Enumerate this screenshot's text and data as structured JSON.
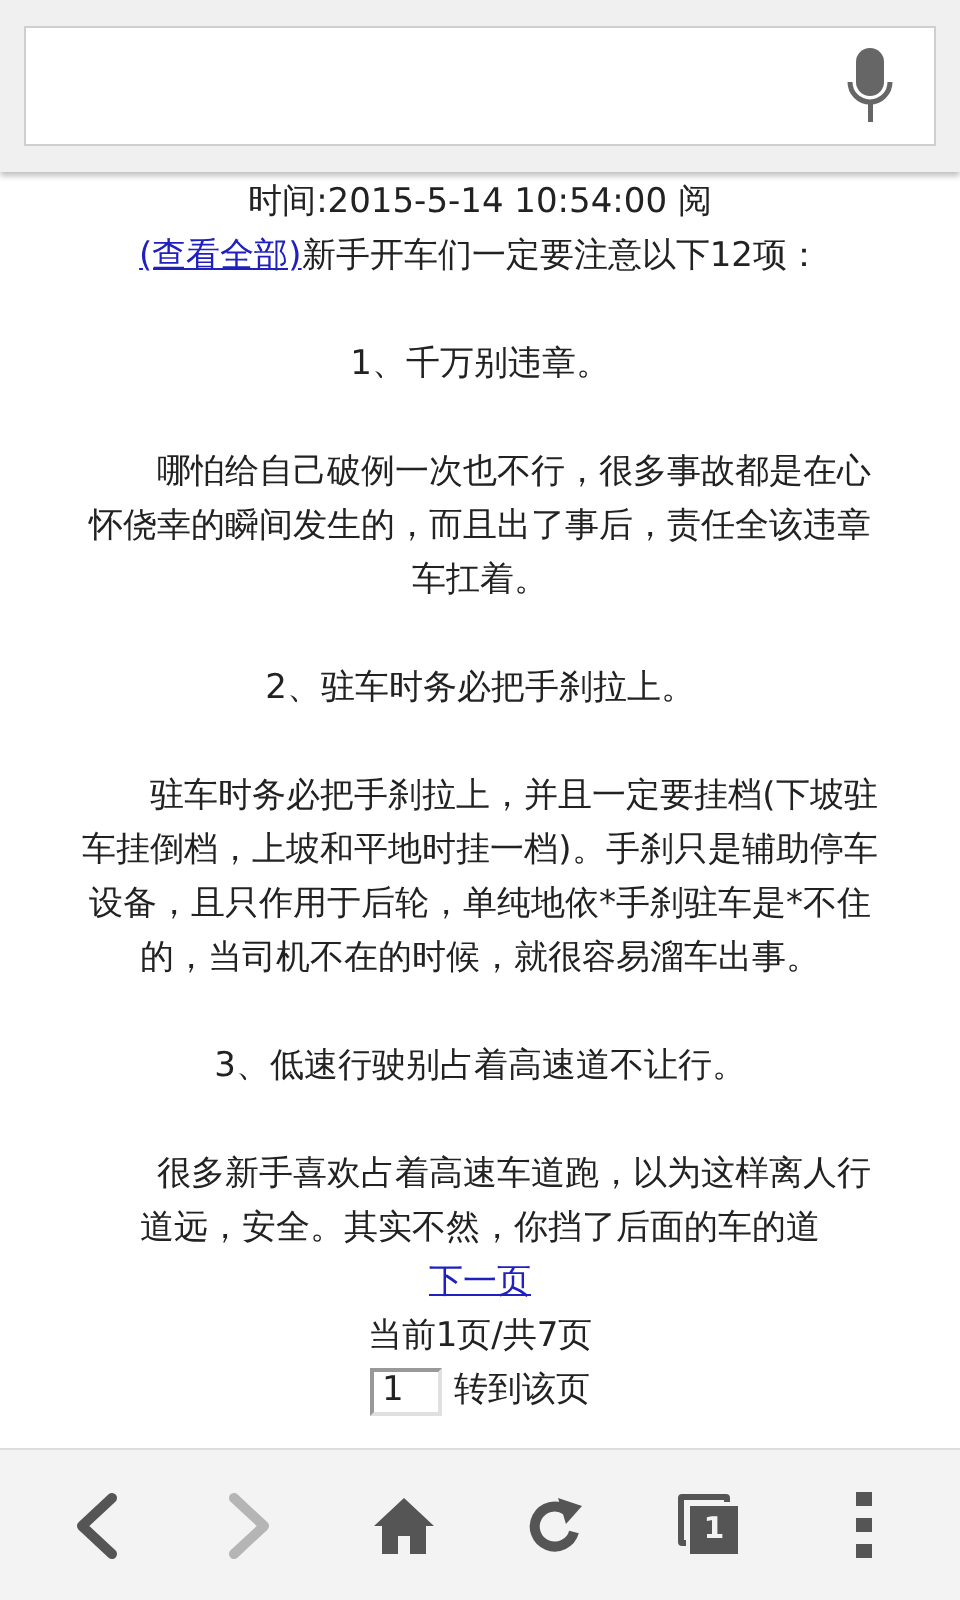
{
  "article": {
    "time": "时间:2015-5-14 10:54:00 阅",
    "intro_link": "(查看全部)",
    "intro_text": "新手开车们一定要注意以下12项：",
    "blocks": [
      {
        "kind": "heading",
        "text": "1、千万别违章。"
      },
      {
        "kind": "paragraph",
        "text": "哪怕给自己破例一次也不行，很多事故都是在心怀侥幸的瞬间发生的，而且出了事后，责任全该违章车扛着。"
      },
      {
        "kind": "heading",
        "text": "2、驻车时务必把手刹拉上。"
      },
      {
        "kind": "paragraph",
        "text": "驻车时务必把手刹拉上，并且一定要挂档(下坡驻车挂倒档，上坡和平地时挂一档)。手刹只是辅助停车设备，且只作用于后轮，单纯地依*手刹驻车是*不住的，当司机不在的时候，就很容易溜车出事。"
      },
      {
        "kind": "heading",
        "text": "3、低速行驶别占着高速道不让行。"
      },
      {
        "kind": "paragraph",
        "text": "很多新手喜欢占着高速车道跑，以为这样离人行道远，安全。其实不然，你挡了后面的车的道"
      }
    ]
  },
  "pagination": {
    "next_link": "下一页",
    "page_info": "当前1页/共7页",
    "page_input": "1",
    "go_label": "转到该页"
  },
  "toolbar": [
    {
      "kind": "back",
      "disabled": false
    },
    {
      "kind": "forward",
      "disabled": true
    },
    {
      "kind": "home",
      "disabled": false
    },
    {
      "kind": "reload",
      "disabled": false
    },
    {
      "kind": "tabs",
      "count": "1",
      "disabled": false
    },
    {
      "kind": "menu",
      "disabled": false
    }
  ]
}
